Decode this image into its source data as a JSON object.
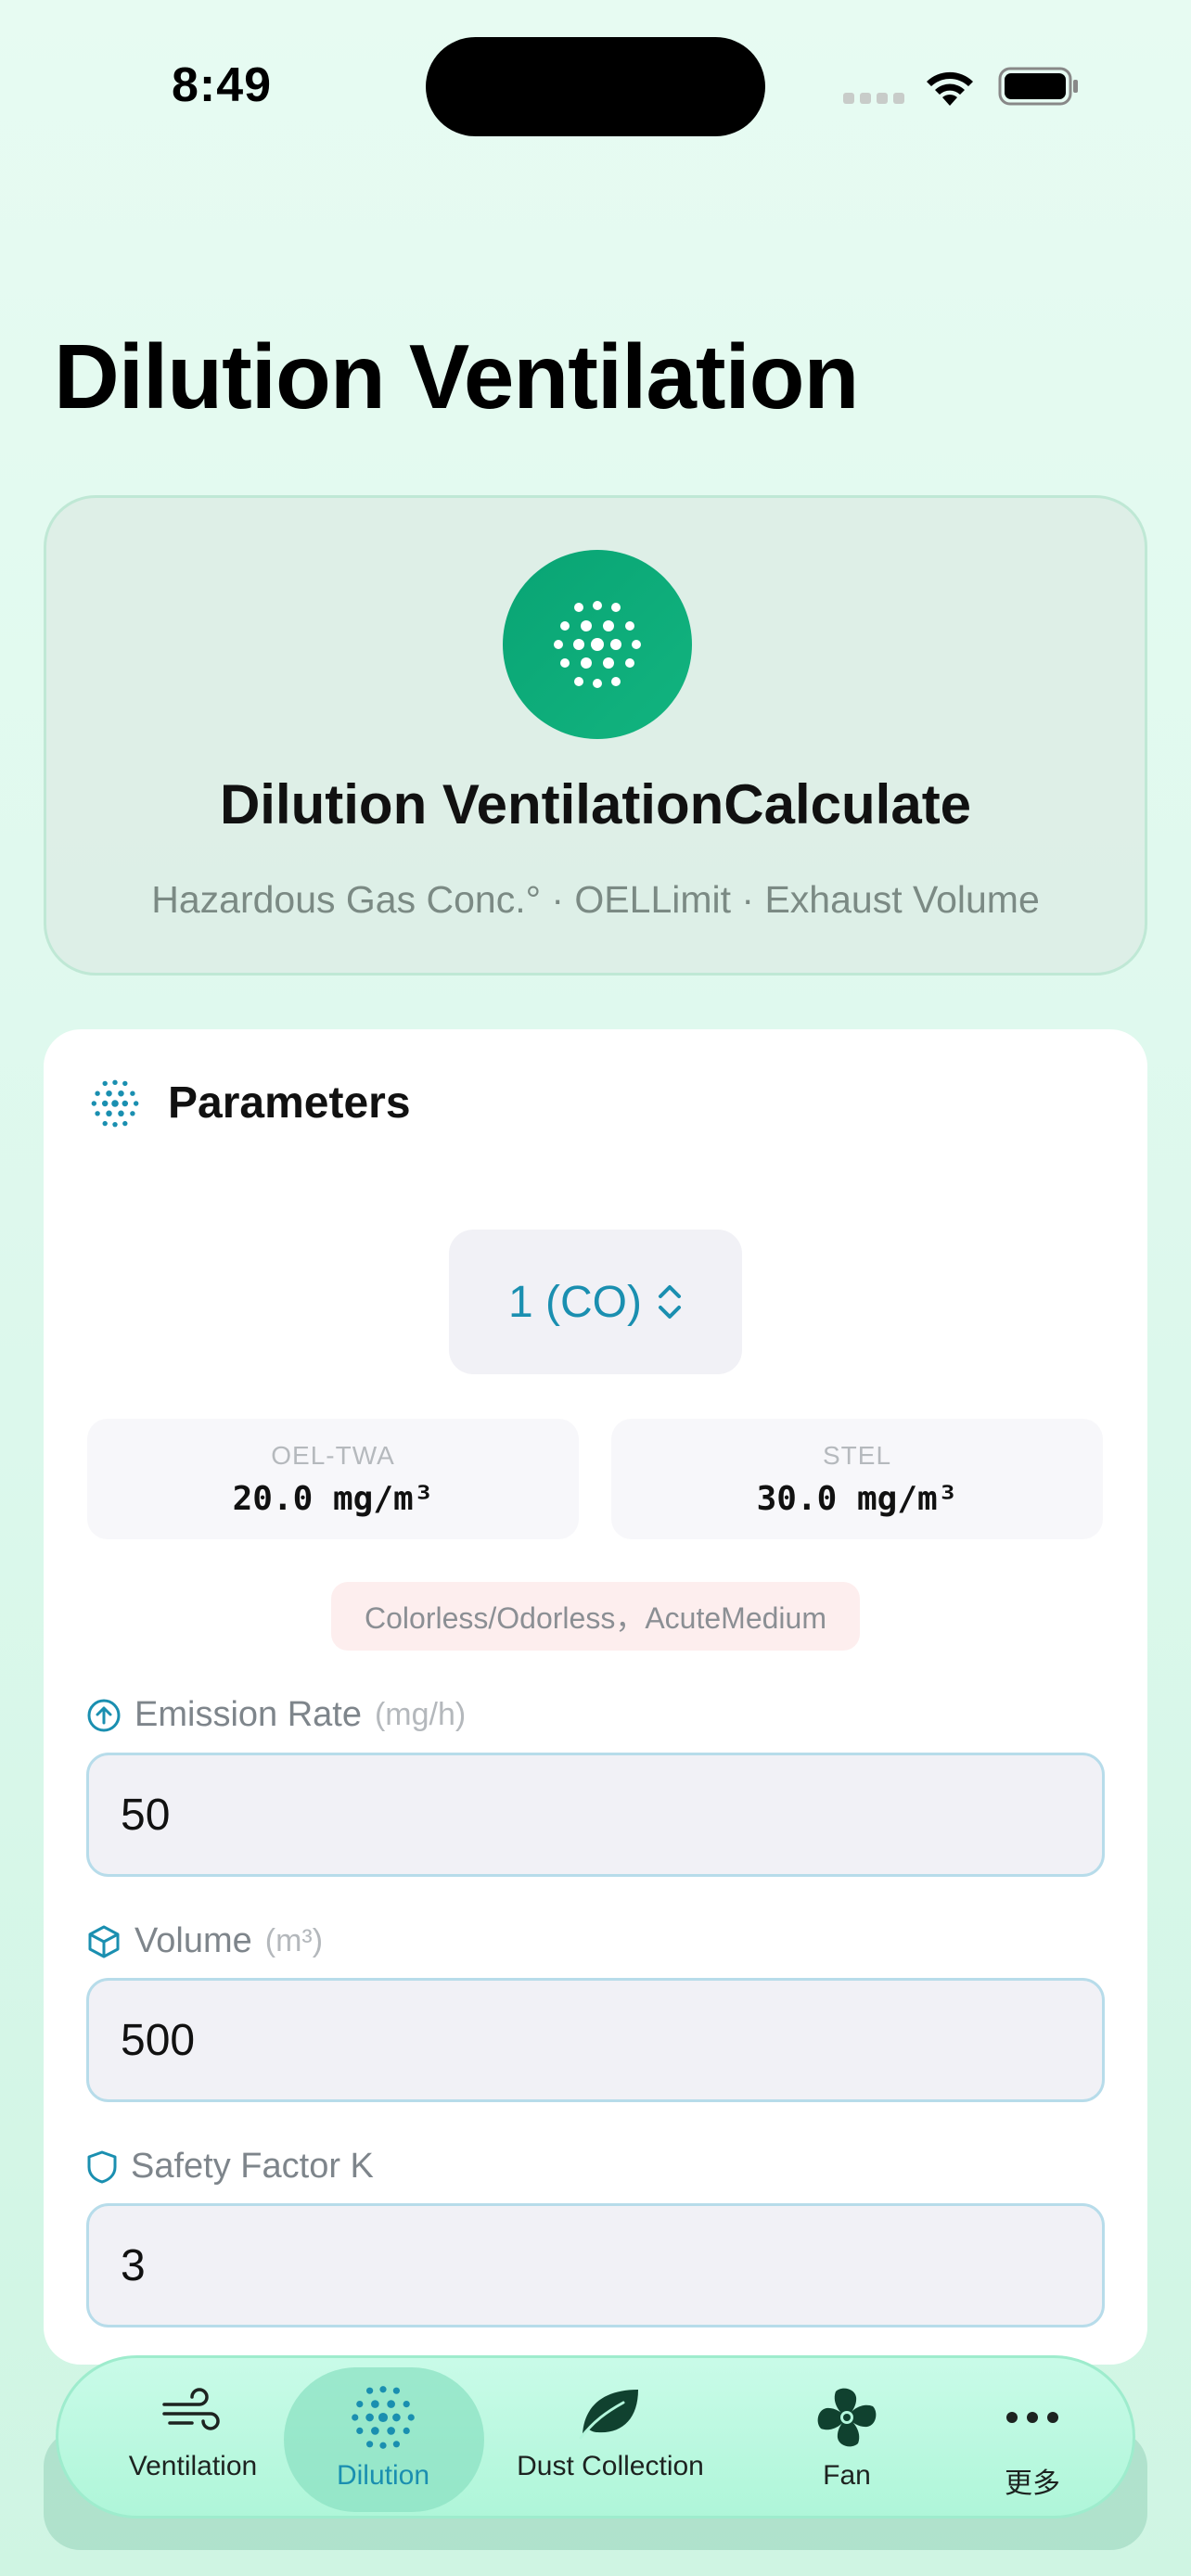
{
  "status_bar": {
    "time": "8:49"
  },
  "page": {
    "title": "Dilution Ventilation"
  },
  "hero": {
    "title": "Dilution VentilationCalculate",
    "subtitle": "Hazardous Gas Conc.° · OELLimit · Exhaust Volume",
    "icon": "dots-grid-icon"
  },
  "params": {
    "title": "Parameters",
    "gas_selected": "1 (CO)",
    "oel_twa": {
      "label": "OEL-TWA",
      "value": "20.0 mg/m³"
    },
    "stel": {
      "label": "STEL",
      "value": "30.0 mg/m³"
    },
    "hazard_note": "Colorless/Odorless，AcuteMedium",
    "emission_rate": {
      "label": "Emission Rate",
      "unit": "(mg/h)",
      "value": "50"
    },
    "volume": {
      "label": "Volume",
      "unit": "(m³)",
      "value": "500"
    },
    "safety_factor": {
      "label": "Safety Factor K",
      "value": "3"
    }
  },
  "tabs": [
    {
      "label": "Ventilation",
      "icon": "wind-icon"
    },
    {
      "label": "Dilution",
      "icon": "dots-grid-icon",
      "active": true
    },
    {
      "label": "Dust Collection",
      "icon": "leaf-icon"
    },
    {
      "label": "Fan",
      "icon": "fan-icon"
    },
    {
      "label": "更多",
      "icon": "ellipsis-icon"
    }
  ],
  "colors": {
    "accent": "#1a8fb0",
    "brand_green": "#0fa877"
  }
}
